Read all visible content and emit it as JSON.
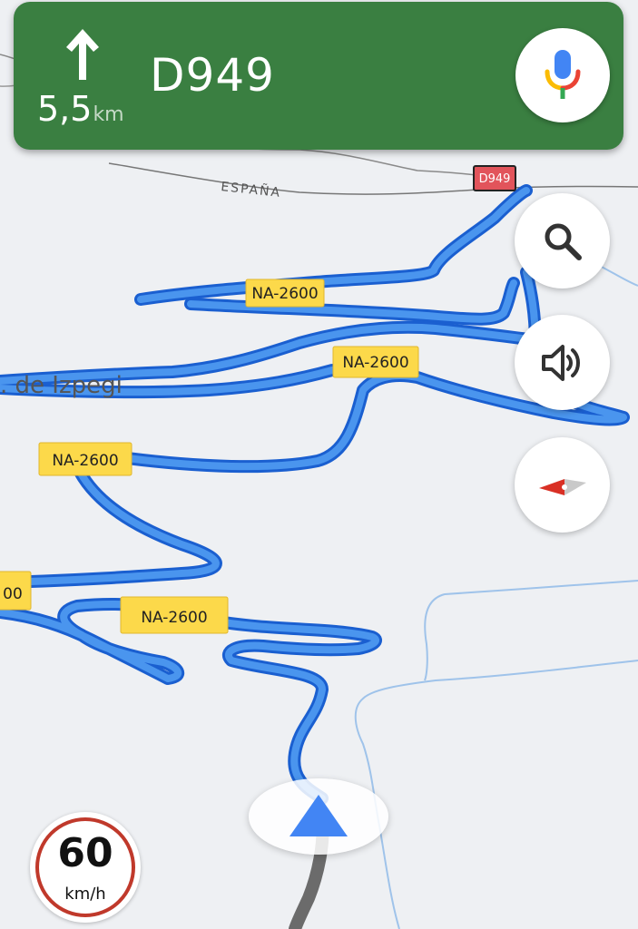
{
  "navigation": {
    "maneuver_icon": "straight-arrow-icon",
    "distance_value": "5,5",
    "distance_unit": "km",
    "next_road": "D949"
  },
  "controls": {
    "mic_icon": "google-mic-icon",
    "search_icon": "search-icon",
    "sound_icon": "volume-icon",
    "compass_icon": "compass-icon"
  },
  "speed_limit": {
    "value": "60",
    "unit": "km/h"
  },
  "map": {
    "shields": [
      {
        "label": "D949",
        "style": "red"
      },
      {
        "label": "NA-2600",
        "style": "yellow"
      },
      {
        "label": "NA-2600",
        "style": "yellow"
      },
      {
        "label": "NA-2600",
        "style": "yellow"
      },
      {
        "label": "NA-2600",
        "style": "yellow"
      },
      {
        "label": "00",
        "style": "yellow"
      }
    ],
    "border_label": "ESPAÑA",
    "place_label": ". de Izpegi"
  },
  "colors": {
    "banner": "#3a7f41",
    "route": "#4285f4",
    "route_outline": "#1a5fd0",
    "traveled": "#666666",
    "shield_yellow": "#fcd94a",
    "shield_red": "#e2545b",
    "speed_ring": "#c0392b"
  }
}
